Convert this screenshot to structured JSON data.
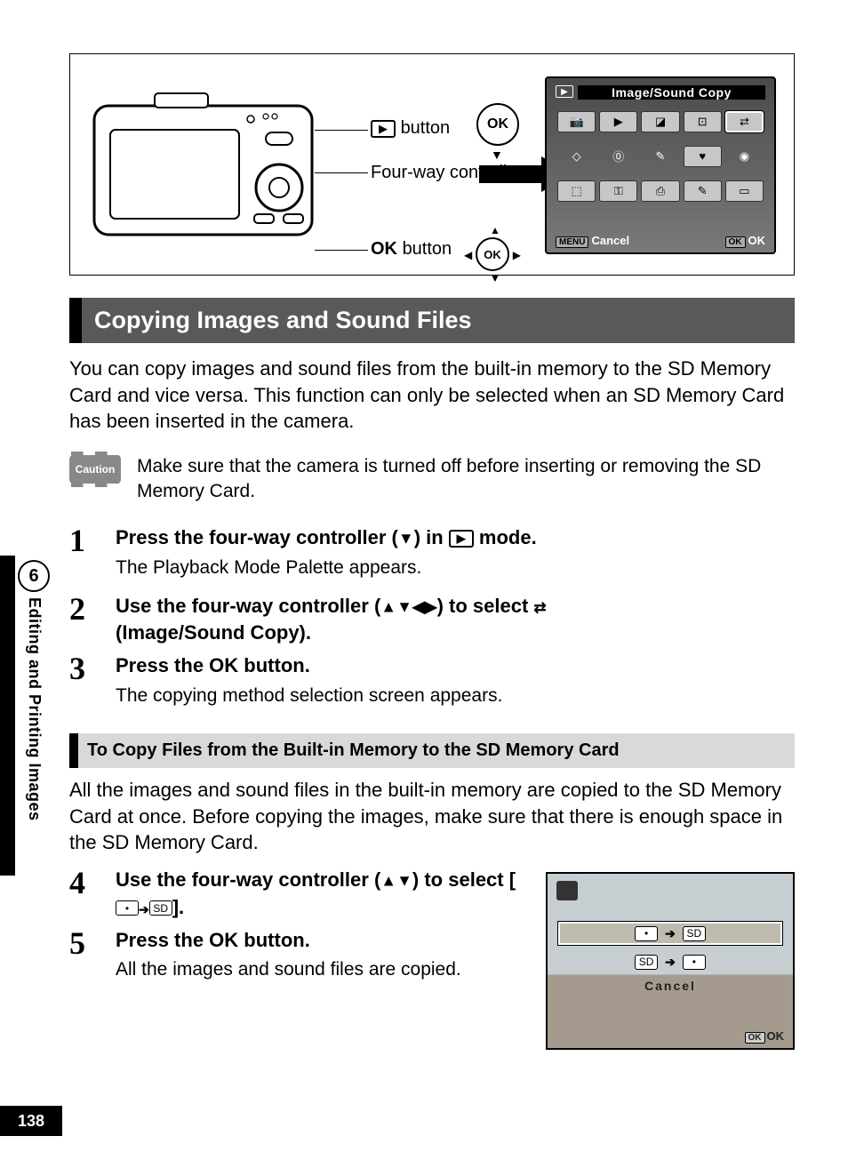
{
  "figure": {
    "label_play_button": "button",
    "label_four_way": "Four-way controller",
    "label_ok_button": "button",
    "ok": "OK",
    "palette_title": "Image/Sound Copy",
    "palette_menu": "MENU",
    "palette_cancel": "Cancel",
    "palette_ok_btn": "OK",
    "palette_ok": "OK"
  },
  "section_title": "Copying Images and Sound Files",
  "intro": "You can copy images and sound files from the built-in memory to the SD Memory Card and vice versa. This function can only be selected when an SD Memory Card has been inserted in the camera.",
  "caution_label": "Caution",
  "caution_text": "Make sure that the camera is turned off before inserting or removing the SD Memory Card.",
  "steps": {
    "s1_num": "1",
    "s1_heading_a": "Press the four-way controller (",
    "s1_heading_b": ") in ",
    "s1_heading_c": " mode.",
    "s1_sub": "The Playback Mode Palette appears.",
    "s2_num": "2",
    "s2_heading_a": "Use the four-way controller (",
    "s2_heading_b": ") to select ",
    "s2_heading_c": "(Image/Sound Copy).",
    "s3_num": "3",
    "s3_heading_a": "Press the ",
    "s3_heading_b": " button.",
    "s3_sub": "The copying method selection screen appears.",
    "ok": "OK"
  },
  "subheading": "To Copy Files from the Built-in Memory to the SD Memory Card",
  "sub_intro": "All the images and sound files in the built-in memory are copied to the SD Memory Card at once. Before copying the images, make sure that there is enough space in the SD Memory Card.",
  "s4_num": "4",
  "s4_heading_a": "Use the four-way controller (",
  "s4_heading_b": ") to select [",
  "s4_heading_c": "].",
  "s5_num": "5",
  "s5_heading_a": "Press the ",
  "s5_heading_b": " button.",
  "s5_sub": "All the images and sound files are copied.",
  "lcd2": {
    "sd": "SD",
    "cancel": "Cancel",
    "ok_btn": "OK",
    "ok": "OK"
  },
  "sidebar": {
    "chapter_num": "6",
    "chapter_title": "Editing and Printing Images"
  },
  "page_number": "138"
}
